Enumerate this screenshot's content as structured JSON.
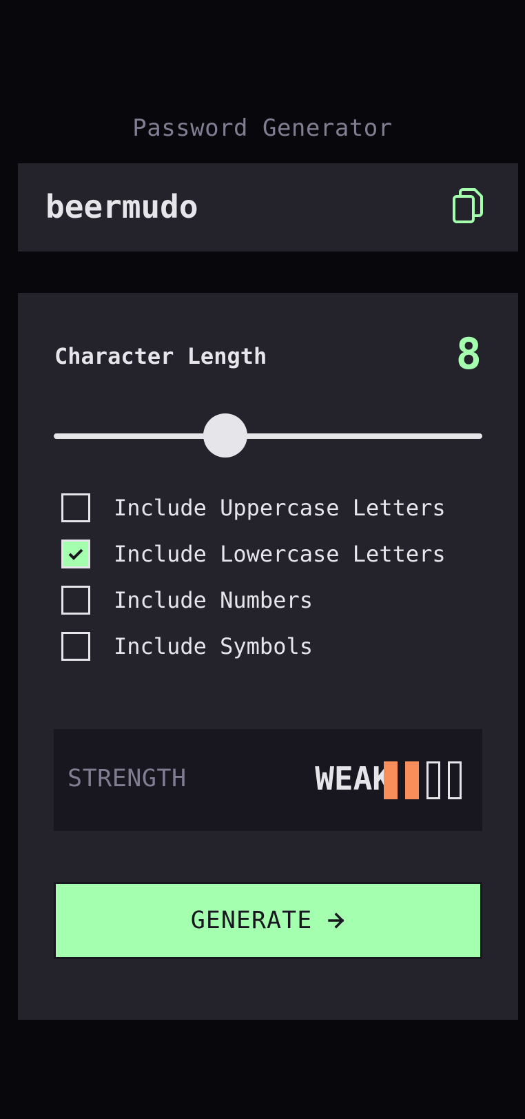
{
  "app": {
    "title": "Password Generator"
  },
  "password": {
    "value": "beermudo",
    "copy_icon": "copy-icon"
  },
  "length": {
    "label": "Character Length",
    "value": "8",
    "min": 0,
    "max": 20,
    "slider_fraction": 0.4
  },
  "options": [
    {
      "label": "Include Uppercase Letters",
      "checked": false
    },
    {
      "label": "Include Lowercase Letters",
      "checked": true
    },
    {
      "label": "Include Numbers",
      "checked": false
    },
    {
      "label": "Include Symbols",
      "checked": false
    }
  ],
  "strength": {
    "label": "STRENGTH",
    "value": "WEAK",
    "level": 2,
    "total": 4,
    "color": "#f98e5b"
  },
  "generate": {
    "label": "GENERATE",
    "icon": "arrow-right-icon"
  },
  "colors": {
    "accent": "#a4ffaf",
    "background": "#08070b",
    "panel": "#24232c",
    "strength_bg": "#18171f",
    "muted": "#817d92",
    "text": "#e6e5ea"
  }
}
